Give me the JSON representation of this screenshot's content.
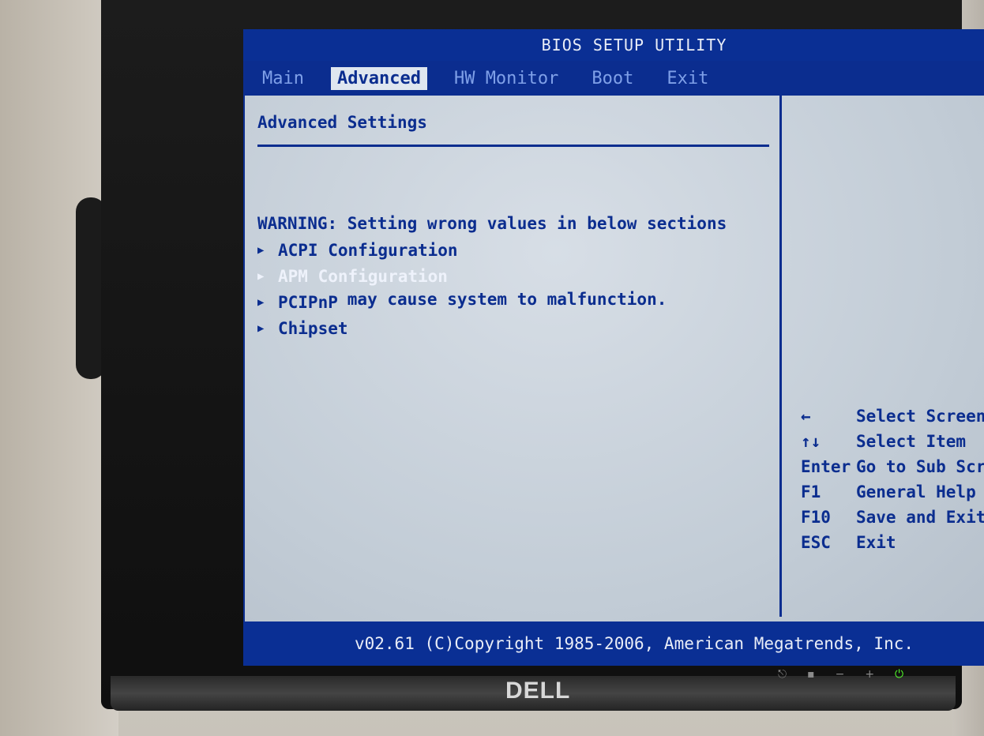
{
  "bios": {
    "title": "BIOS SETUP UTILITY",
    "menu_tabs": [
      {
        "label": "Main"
      },
      {
        "label": "Advanced"
      },
      {
        "label": "HW Monitor"
      },
      {
        "label": "Boot"
      },
      {
        "label": "Exit"
      }
    ],
    "active_tab": "Advanced",
    "section_title": "Advanced Settings",
    "warning_line_1": "WARNING: Setting wrong values in below sections",
    "warning_line_2": "         may cause system to malfunction.",
    "menu_items": [
      {
        "label": "ACPI Configuration",
        "selected": false
      },
      {
        "label": "APM Configuration",
        "selected": true
      },
      {
        "label": "PCIPnP",
        "selected": false
      },
      {
        "label": "Chipset",
        "selected": false
      }
    ],
    "help_keys": [
      {
        "key": "←",
        "action": "Select Screen"
      },
      {
        "key": "↑↓",
        "action": "Select Item"
      },
      {
        "key": "Enter",
        "action": "Go to Sub Screen"
      },
      {
        "key": "F1",
        "action": "General Help"
      },
      {
        "key": "F10",
        "action": "Save and Exit"
      },
      {
        "key": "ESC",
        "action": "Exit"
      }
    ],
    "footer": "v02.61 (C)Copyright 1985-2006, American Megatrends, Inc."
  },
  "monitor": {
    "brand": "DELL",
    "power_led_color": "#53ff2a",
    "accent_color": "#0b2d8f"
  }
}
